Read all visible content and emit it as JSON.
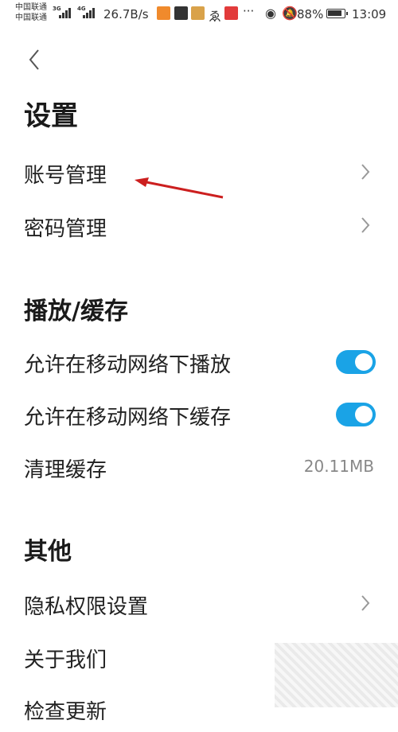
{
  "status_bar": {
    "carrier_1": "中国联通",
    "carrier_2": "中国联通",
    "net_1": "3G",
    "net_2": "4G",
    "speed": "26.7B/s",
    "dots": "···",
    "battery": "88%",
    "time": "13:09"
  },
  "page": {
    "title": "设置"
  },
  "sections": {
    "account": {
      "items": [
        {
          "label": "账号管理"
        },
        {
          "label": "密码管理"
        }
      ]
    },
    "playback": {
      "title": "播放/缓存",
      "items": [
        {
          "label": "允许在移动网络下播放",
          "enabled": true
        },
        {
          "label": "允许在移动网络下缓存",
          "enabled": true
        },
        {
          "label": "清理缓存",
          "value": "20.11MB"
        }
      ]
    },
    "other": {
      "title": "其他",
      "items": [
        {
          "label": "隐私权限设置"
        },
        {
          "label": "关于我们"
        },
        {
          "label": "检查更新"
        }
      ]
    }
  },
  "colors": {
    "toggle_on": "#1aa3e6",
    "annotation_arrow": "#cc1f1f"
  }
}
